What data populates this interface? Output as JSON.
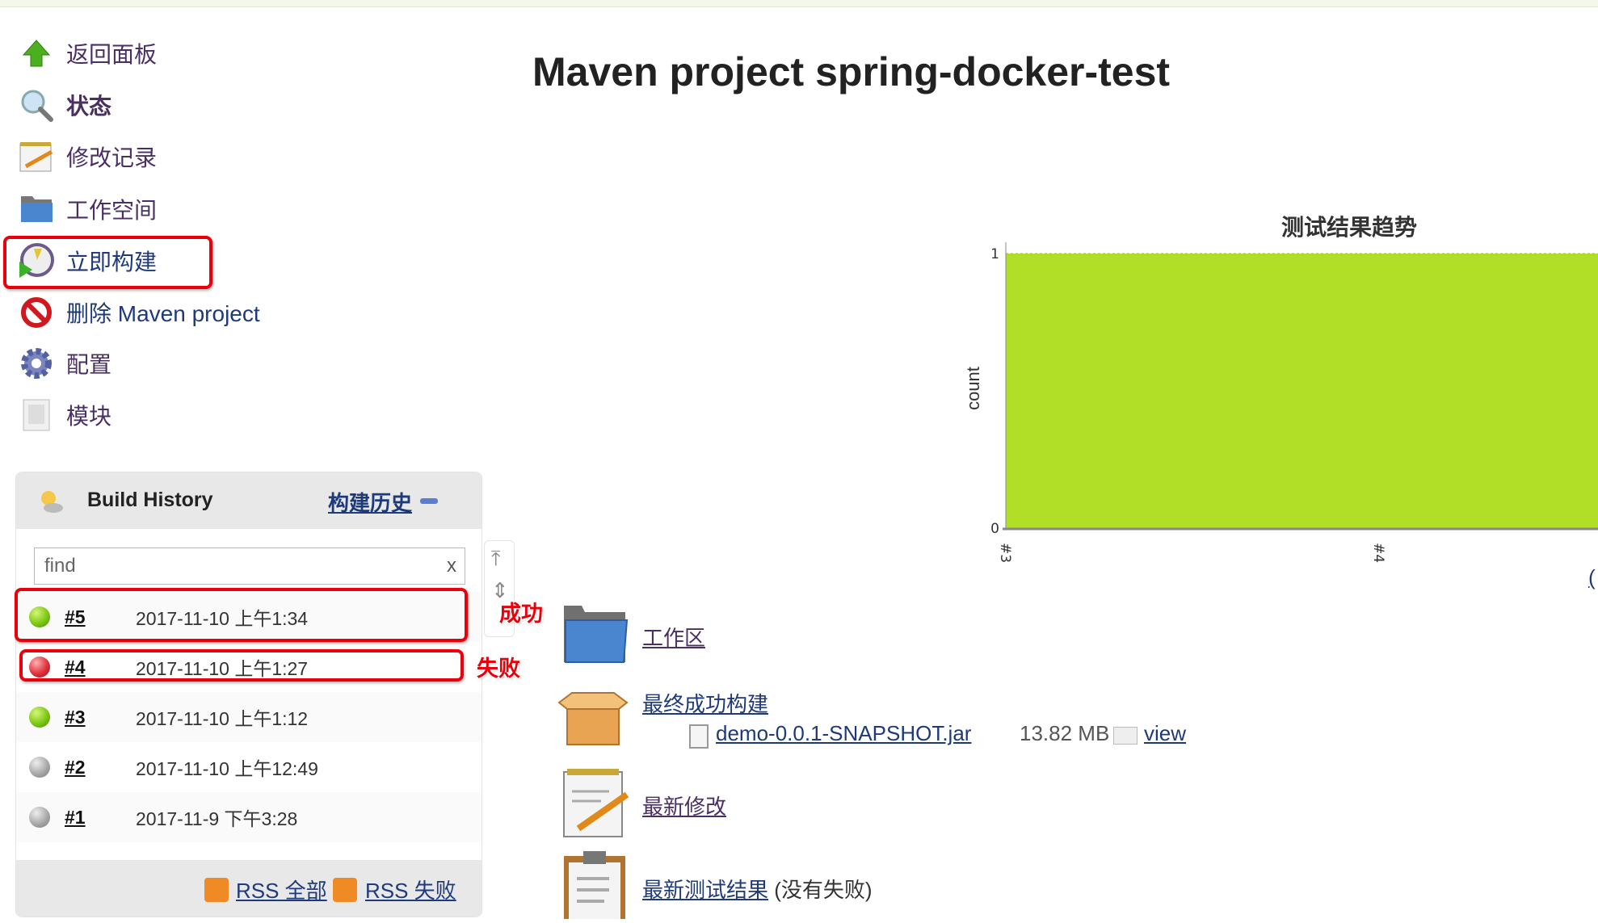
{
  "sidebar": {
    "items": [
      {
        "label": "返回面板",
        "icon": "up-arrow-icon"
      },
      {
        "label": "状态",
        "icon": "search-icon"
      },
      {
        "label": "修改记录",
        "icon": "notepad-icon"
      },
      {
        "label": "工作空间",
        "icon": "folder-icon"
      },
      {
        "label": "立即构建",
        "icon": "build-clock-icon"
      },
      {
        "label": "删除 Maven project",
        "icon": "no-entry-icon"
      },
      {
        "label": "配置",
        "icon": "gear-icon"
      },
      {
        "label": "模块",
        "icon": "module-icon"
      }
    ]
  },
  "page_title": "Maven project spring-docker-test",
  "build_history": {
    "title": "Build History",
    "link": "构建历史",
    "find_placeholder": "find",
    "clear": "x",
    "builds": [
      {
        "number": "#5",
        "date": "2017-11-10 上午1:34",
        "status": "success",
        "color": "#7cc814"
      },
      {
        "number": "#4",
        "date": "2017-11-10 上午1:27",
        "status": "failed",
        "color": "#e0303a"
      },
      {
        "number": "#3",
        "date": "2017-11-10 上午1:12",
        "status": "success",
        "color": "#7cc814"
      },
      {
        "number": "#2",
        "date": "2017-11-10 上午12:49",
        "status": "not-built",
        "color": "#a9a9a9"
      },
      {
        "number": "#1",
        "date": "2017-11-9 下午3:28",
        "status": "not-built",
        "color": "#a9a9a9"
      }
    ],
    "rss_all": "RSS 全部",
    "rss_failed": "RSS 失败"
  },
  "annotations": {
    "success": "成功",
    "failed": "失败"
  },
  "links": {
    "workspace": "工作区",
    "last_success": "最终成功构建",
    "artifact": "demo-0.0.1-SNAPSHOT.jar",
    "artifact_size": "13.82 MB",
    "view": "view",
    "latest_changes": "最新修改",
    "latest_tests": "最新测试结果",
    "latest_tests_note": "(没有失败)",
    "partial_link": "("
  },
  "chart_data": {
    "type": "area",
    "title": "测试结果趋势",
    "ylabel": "count",
    "xlabel": "",
    "categories": [
      "#3",
      "#4"
    ],
    "series": [
      {
        "values": [
          1,
          1
        ],
        "color": "#b1de27"
      }
    ],
    "ylim": [
      0,
      1
    ],
    "yticks": [
      "0",
      "1"
    ],
    "grid": false
  }
}
